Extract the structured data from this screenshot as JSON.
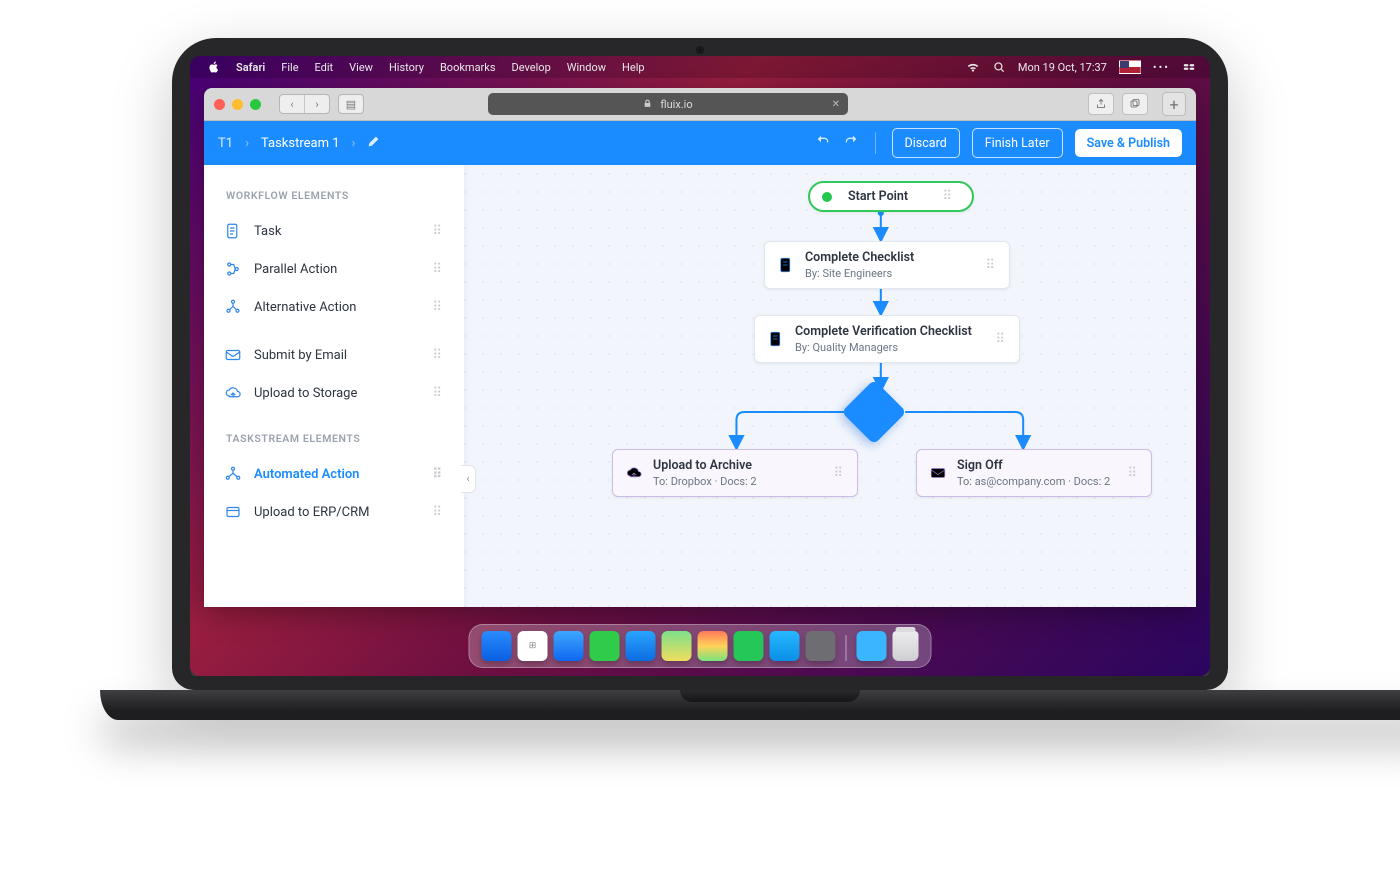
{
  "os": {
    "app_name": "Safari",
    "menu": [
      "File",
      "Edit",
      "View",
      "History",
      "Bookmarks",
      "Develop",
      "Window",
      "Help"
    ],
    "clock": "Mon 19 Oct, 17:37"
  },
  "browser": {
    "url_domain": "fluix.io"
  },
  "app": {
    "breadcrumb_root": "T1",
    "breadcrumb_name": "Taskstream 1",
    "actions": {
      "discard": "Discard",
      "finish_later": "Finish Later",
      "save_publish": "Save & Publish"
    }
  },
  "sidebar": {
    "workflow_label": "WORKFLOW ELEMENTS",
    "workflow": [
      {
        "label": "Task"
      },
      {
        "label": "Parallel Action"
      },
      {
        "label": "Alternative Action"
      },
      {
        "label": "Submit by Email"
      },
      {
        "label": "Upload to Storage"
      }
    ],
    "taskstream_label": "TASKSTREAM ELEMENTS",
    "taskstream": [
      {
        "label": "Automated Action"
      },
      {
        "label": "Upload to ERP/CRM"
      }
    ]
  },
  "flow": {
    "start_label": "Start Point",
    "n1_title": "Complete Checklist",
    "n1_sub": "By: Site Engineers",
    "n2_title": "Complete Verification Checklist",
    "n2_sub": "By: Quality Managers",
    "n3_title": "Upload to Archive",
    "n3_sub": "To: Dropbox  ·  Docs: 2",
    "n4_title": "Sign Off",
    "n4_sub": "To: as@company.com  ·  Docs: 2"
  }
}
